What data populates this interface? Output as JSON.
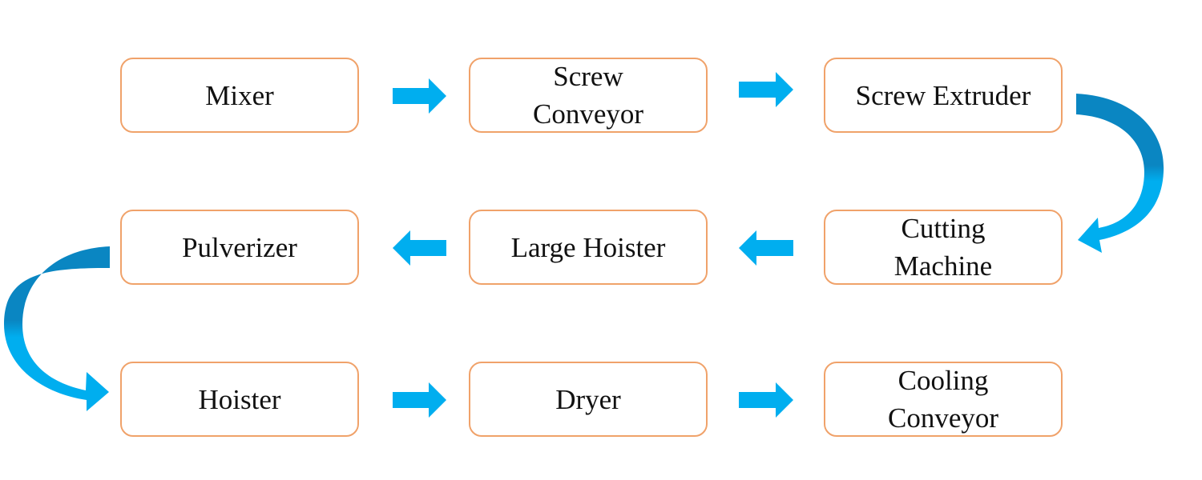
{
  "steps": [
    {
      "label": "Mixer"
    },
    {
      "label": "Screw\nConveyor"
    },
    {
      "label": "Screw Extruder"
    },
    {
      "label": "Cutting\nMachine"
    },
    {
      "label": "Large Hoister"
    },
    {
      "label": "Pulverizer"
    },
    {
      "label": "Hoister"
    },
    {
      "label": "Dryer"
    },
    {
      "label": "Cooling\nConveyor"
    }
  ],
  "colors": {
    "box_border": "#f0a26a",
    "arrow": "#00aeef",
    "arrow_dark": "#0a86c2"
  }
}
